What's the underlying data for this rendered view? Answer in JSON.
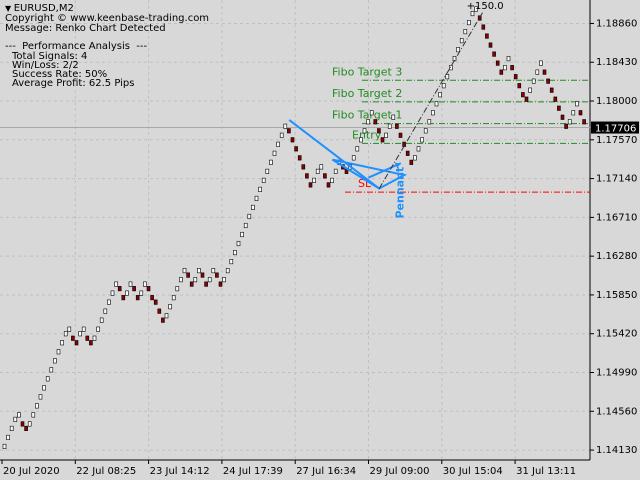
{
  "symbol_label": "EURUSD,M2",
  "copyright": "Copyright © www.keenbase-trading.com",
  "message": "Message: Renko Chart Detected",
  "perf": {
    "header": "---  Performance Analysis  ---",
    "lines": [
      "Total Signals: 4",
      "Win/Loss: 2/2",
      "Success Rate: 50%",
      "Average Profit: 62.5 Pips"
    ]
  },
  "colors": {
    "background": "#d8d8d8",
    "grid": "#c0c0c0",
    "bull": "#ffffff",
    "bear": "#8b0000",
    "pattern": "#1e90ff",
    "fibo": "#228b22",
    "sl": "#ff0000",
    "price_box": "#000000"
  },
  "chart_data": {
    "type": "renko",
    "x_tick_labels": [
      "20 Jul 2020",
      "22 Jul 08:25",
      "23 Jul 14:12",
      "24 Jul 17:39",
      "27 Jul 16:34",
      "29 Jul 09:00",
      "30 Jul 15:04",
      "31 Jul 13:11"
    ],
    "y_tick_labels": [
      "1.18860",
      "1.18430",
      "1.18000",
      "1.17570",
      "1.17140",
      "1.16710",
      "1.16280",
      "1.15850",
      "1.15420",
      "1.14990",
      "1.14560",
      "1.14130"
    ],
    "ylim": [
      1.1402,
      1.1912
    ],
    "current_price": "1.17706",
    "current_price_value": 1.17706,
    "brick_size": 0.0005,
    "brick_centers": [
      1.1417,
      1.1427,
      1.1437,
      1.1447,
      1.1452,
      1.1442,
      1.1437,
      1.1442,
      1.1452,
      1.1462,
      1.1472,
      1.1482,
      1.1492,
      1.1502,
      1.1512,
      1.1522,
      1.1532,
      1.1542,
      1.1547,
      1.1537,
      1.1532,
      1.1542,
      1.1547,
      1.1537,
      1.1532,
      1.1537,
      1.1547,
      1.1557,
      1.1567,
      1.1577,
      1.1587,
      1.1597,
      1.1592,
      1.1582,
      1.1587,
      1.1597,
      1.1592,
      1.1582,
      1.1587,
      1.1597,
      1.1592,
      1.1582,
      1.1577,
      1.1567,
      1.1557,
      1.1562,
      1.1572,
      1.1582,
      1.1592,
      1.1602,
      1.1612,
      1.1607,
      1.1597,
      1.1602,
      1.1612,
      1.1607,
      1.1597,
      1.1602,
      1.1612,
      1.1607,
      1.1597,
      1.1602,
      1.1612,
      1.1622,
      1.1632,
      1.1642,
      1.1652,
      1.1662,
      1.1672,
      1.1682,
      1.1692,
      1.1702,
      1.1712,
      1.1722,
      1.1732,
      1.1742,
      1.1752,
      1.1762,
      1.1772,
      1.1767,
      1.1757,
      1.1747,
      1.1737,
      1.1727,
      1.1717,
      1.1707,
      1.1712,
      1.1722,
      1.1727,
      1.1717,
      1.1707,
      1.1712,
      1.1722,
      1.1732,
      1.1727,
      1.1722,
      1.1727,
      1.1737,
      1.1747,
      1.1757,
      1.1767,
      1.1777,
      1.1787,
      1.1777,
      1.1767,
      1.1757,
      1.1762,
      1.1772,
      1.1782,
      1.1772,
      1.1762,
      1.1752,
      1.1742,
      1.1732,
      1.1737,
      1.1747,
      1.1757,
      1.1767,
      1.1777,
      1.1787,
      1.1797,
      1.1807,
      1.1817,
      1.1827,
      1.1837,
      1.1847,
      1.1857,
      1.1867,
      1.1877,
      1.1887,
      1.1897,
      1.1902,
      1.1892,
      1.1882,
      1.1872,
      1.1862,
      1.1852,
      1.1842,
      1.1832,
      1.1837,
      1.1847,
      1.1837,
      1.1827,
      1.1817,
      1.1807,
      1.1802,
      1.1812,
      1.1822,
      1.1832,
      1.1842,
      1.1832,
      1.1822,
      1.1812,
      1.1802,
      1.1792,
      1.1782,
      1.1772,
      1.1777,
      1.1787,
      1.1797,
      1.1787,
      1.1777
    ],
    "pattern_label": "Pennant",
    "pattern_points": [
      [
        79,
        1.1779
      ],
      [
        104,
        1.1703
      ],
      [
        111,
        1.1718
      ],
      [
        91,
        1.1735
      ],
      [
        104,
        1.1703
      ]
    ],
    "arrow_from": [
      101,
      1.1715
    ],
    "arrow_to": [
      110,
      1.1731
    ],
    "target_label": "+150.0",
    "target_from": [
      104,
      1.1703
    ],
    "target_to": [
      133,
      1.19
    ],
    "levels": [
      {
        "label": "Fibo Target 3",
        "value": 1.1823,
        "style": "dashdot",
        "color": "#228b22"
      },
      {
        "label": "Fibo Target 2",
        "value": 1.1799,
        "style": "dashdot",
        "color": "#228b22"
      },
      {
        "label": "Fibo Target 1",
        "value": 1.1775,
        "style": "dashdot",
        "color": "#228b22"
      },
      {
        "label": "Entry",
        "value": 1.1753,
        "style": "dashdot",
        "color": "#228b22"
      },
      {
        "label": "SL",
        "value": 1.1699,
        "style": "dashdot",
        "color": "#ff0000"
      }
    ]
  }
}
